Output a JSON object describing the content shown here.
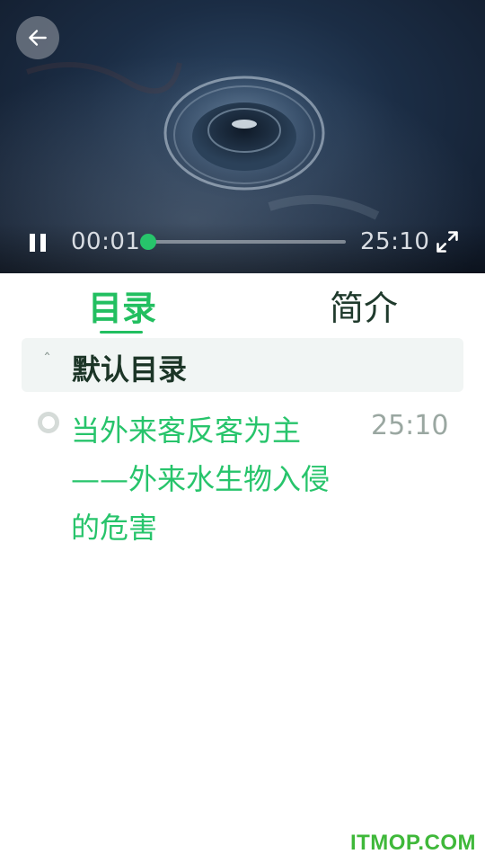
{
  "player": {
    "current_time": "00:01",
    "total_time": "25:10",
    "progress": 0.0007,
    "accent_color": "#27c46b",
    "icons": {
      "back": "arrow-left-icon",
      "pause": "pause-icon",
      "fullscreen": "fullscreen-icon"
    }
  },
  "tabs": [
    {
      "label": "目录",
      "active": true
    },
    {
      "label": "简介",
      "active": false
    }
  ],
  "catalog": {
    "section_title": "默认目录",
    "section_icon": "chevron-up-icon",
    "episodes": [
      {
        "title": "当外来客反客为主——外来水生物入侵的危害",
        "duration": "25:10",
        "status_icon": "radio-dot-icon"
      }
    ]
  },
  "watermark": "ITMOP.COM",
  "colors": {
    "active_green": "#22bf60",
    "text_dark": "#1c3527",
    "muted_gray": "#9aa7a1",
    "section_bg": "#f1f5f4"
  }
}
